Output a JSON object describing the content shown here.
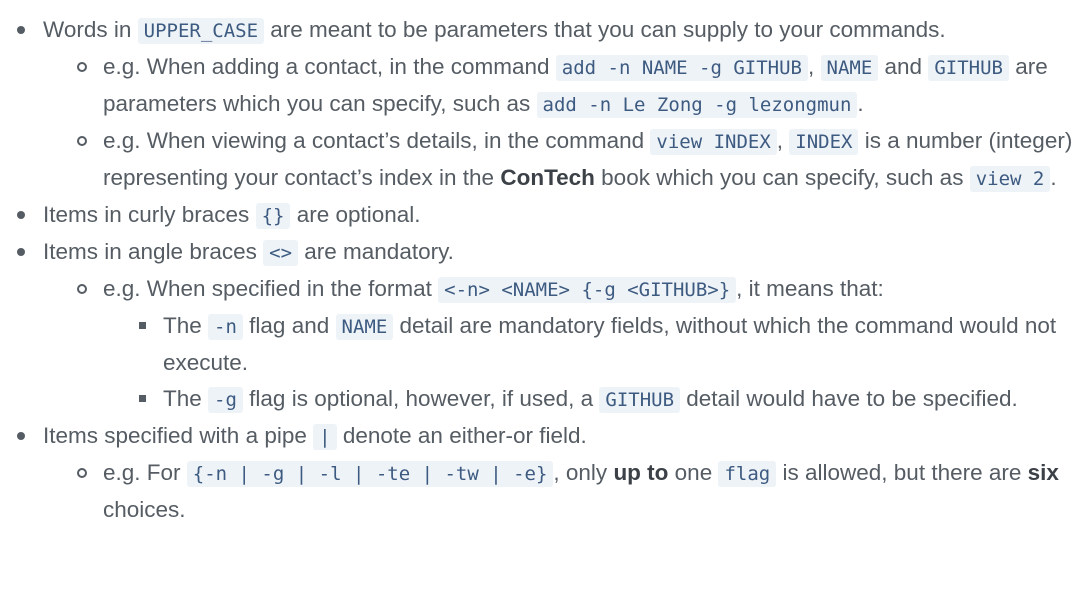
{
  "items": {
    "words": {
      "pre": "Words in ",
      "code": "UPPER_CASE",
      "post": " are meant to be parameters that you can supply to your commands.",
      "example1": {
        "t1": "e.g. When adding a contact, in the command ",
        "c1": "add -n NAME -g GITHUB",
        "t2": ", ",
        "c2": "NAME",
        "t3": " and ",
        "c3": "GITHUB",
        "t4": " are parameters which you can specify, such as ",
        "c4": "add -n Le Zong -g lezongmun",
        "t5": "."
      },
      "example2": {
        "t1": "e.g. When viewing a contact’s details, in the command ",
        "c1": "view INDEX",
        "t2": ", ",
        "c2": "INDEX",
        "t3": " is a number (integer) representing your contact’s index in the ",
        "b1": "ConTech",
        "t4": " book which you can specify, such as ",
        "c3": "view 2",
        "t5": "."
      }
    },
    "curly": {
      "pre": "Items in curly braces ",
      "code": "{}",
      "post": " are optional."
    },
    "angle": {
      "pre": "Items in angle braces ",
      "code": "<>",
      "post": " are mandatory.",
      "example": {
        "t1": "e.g. When specified in the format ",
        "c1": "<-n> <NAME> {-g <GITHUB>}",
        "t2": ", it means that:",
        "sub1": {
          "t1": "The ",
          "c1": "-n",
          "t2": " flag and ",
          "c2": "NAME",
          "t3": " detail are mandatory fields, without which the command would not execute."
        },
        "sub2": {
          "t1": "The ",
          "c1": "-g",
          "t2": " flag is optional, however, if used, a ",
          "c2": "GITHUB",
          "t3": " detail would have to be specified."
        }
      }
    },
    "pipe": {
      "pre": "Items specified with a pipe ",
      "code": "|",
      "post": " denote an either-or field.",
      "example": {
        "t1": "e.g. For ",
        "c1": "{-n | -g | -l | -te | -tw | -e}",
        "t2": ", only ",
        "b1": "up to",
        "t3": " one ",
        "c2": "flag",
        "t4": " is allowed, but there are ",
        "b2": "six",
        "t5": " choices."
      }
    }
  }
}
